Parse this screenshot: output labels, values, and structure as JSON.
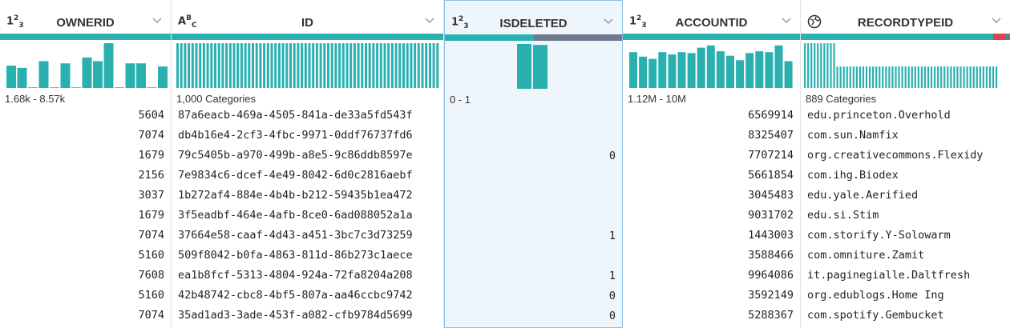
{
  "columns": [
    {
      "key": "ownerid",
      "name": "OWNERID",
      "type": "integer",
      "range": "1.68k - 8.57k"
    },
    {
      "key": "id",
      "name": "ID",
      "type": "string",
      "range": "1,000 Categories"
    },
    {
      "key": "isdeleted",
      "name": "ISDELETED",
      "type": "integer",
      "range": "0 - 1"
    },
    {
      "key": "accountid",
      "name": "ACCOUNTID",
      "type": "integer",
      "range": "1.12M - 10M"
    },
    {
      "key": "recordtypeid",
      "name": "RECORDTYPEID",
      "type": "url",
      "range": "889 Categories"
    }
  ],
  "colors": {
    "accent": "#2bb0b0",
    "missing": "#6d7a8c",
    "error": "#e04050",
    "selected_bg": "#eef6fc",
    "selected_border": "#8fc0e8"
  },
  "quality": {
    "isdeleted": {
      "valid": 0.5,
      "missing": 0.5
    },
    "recordtypeid": {
      "valid": 0.92,
      "error": 0.06,
      "missing": 0.02
    }
  },
  "histograms": {
    "ownerid": [
      0.5,
      0.45,
      0,
      0.6,
      0,
      0.55,
      0,
      0.68,
      0.6,
      1.0,
      0,
      0.55,
      0.55,
      0,
      0.48
    ],
    "id": [
      1,
      1,
      1,
      1,
      1,
      1,
      1,
      1,
      1,
      1,
      1,
      1,
      1,
      1,
      1,
      1,
      1,
      1,
      1,
      1,
      1,
      1,
      1,
      1,
      1,
      1,
      1,
      1,
      1,
      1,
      1,
      1,
      1,
      1,
      1,
      1,
      1,
      1,
      1,
      1,
      1,
      1,
      1,
      1,
      1,
      1,
      1,
      1,
      1,
      1,
      1,
      1,
      1,
      1,
      1,
      1,
      1,
      1,
      1,
      1,
      1,
      1,
      1,
      1,
      1,
      1,
      1,
      1,
      1,
      1
    ],
    "isdeleted": [
      1.0,
      0.98
    ],
    "accountid": [
      0.8,
      0.7,
      0.65,
      0.8,
      0.75,
      0.8,
      0.78,
      0.9,
      0.95,
      0.82,
      0.72,
      0.62,
      0.78,
      0.82,
      0.8,
      0.95,
      0.6
    ],
    "recordtypeid": [
      1,
      1,
      1,
      1,
      1,
      1,
      1,
      1,
      1,
      1,
      0.48,
      0.48,
      0.48,
      0.48,
      0.48,
      0.48,
      0.48,
      0.48,
      0.48,
      0.48,
      0.48,
      0.48,
      0.48,
      0.48,
      0.48,
      0.48,
      0.48,
      0.48,
      0.48,
      0.48,
      0.48,
      0.48,
      0.48,
      0.48,
      0.48,
      0.48,
      0.48,
      0.48,
      0.48,
      0.48,
      0.48,
      0.48,
      0.48,
      0.48,
      0.48,
      0.48,
      0.48,
      0.48,
      0.48,
      0.48,
      0.48,
      0.48,
      0.48,
      0.48,
      0.48,
      0.48,
      0.48,
      0.48,
      0.48,
      0.48
    ]
  },
  "rows": [
    {
      "ownerid": "5604",
      "id": "87a6eacb-469a-4505-841a-de33a5fd543f",
      "isdeleted": "",
      "accountid": "6569914",
      "recordtypeid": "edu.princeton.Overhold"
    },
    {
      "ownerid": "7074",
      "id": "db4b16e4-2cf3-4fbc-9971-0ddf76737fd6",
      "isdeleted": "",
      "accountid": "8325407",
      "recordtypeid": "com.sun.Namfix"
    },
    {
      "ownerid": "1679",
      "id": "79c5405b-a970-499b-a8e5-9c86ddb8597e",
      "isdeleted": "0",
      "accountid": "7707214",
      "recordtypeid": "org.creativecommons.Flexidy"
    },
    {
      "ownerid": "2156",
      "id": "7e9834c6-dcef-4e49-8042-6d0c2816aebf",
      "isdeleted": "",
      "accountid": "5661854",
      "recordtypeid": "com.ihg.Biodex"
    },
    {
      "ownerid": "3037",
      "id": "1b272af4-884e-4b4b-b212-59435b1ea472",
      "isdeleted": "",
      "accountid": "3045483",
      "recordtypeid": "edu.yale.Aerified"
    },
    {
      "ownerid": "1679",
      "id": "3f5eadbf-464e-4afb-8ce0-6ad088052a1a",
      "isdeleted": "",
      "accountid": "9031702",
      "recordtypeid": "edu.si.Stim"
    },
    {
      "ownerid": "7074",
      "id": "37664e58-caaf-4d43-a451-3bc7c3d73259",
      "isdeleted": "1",
      "accountid": "1443003",
      "recordtypeid": "com.storify.Y-Solowarm"
    },
    {
      "ownerid": "5160",
      "id": "509f8042-b0fa-4863-811d-86b273c1aece",
      "isdeleted": "",
      "accountid": "3588466",
      "recordtypeid": "com.omniture.Zamit"
    },
    {
      "ownerid": "7608",
      "id": "ea1b8fcf-5313-4804-924a-72fa8204a208",
      "isdeleted": "1",
      "accountid": "9964086",
      "recordtypeid": "it.paginegialle.Daltfresh"
    },
    {
      "ownerid": "5160",
      "id": "42b48742-cbc8-4bf5-807a-aa46ccbc9742",
      "isdeleted": "0",
      "accountid": "3592149",
      "recordtypeid": "org.edublogs.Home Ing"
    },
    {
      "ownerid": "7074",
      "id": "35ad1ad3-3ade-453f-a082-cfb9784d5699",
      "isdeleted": "0",
      "accountid": "5288367",
      "recordtypeid": "com.spotify.Gembucket"
    }
  ]
}
